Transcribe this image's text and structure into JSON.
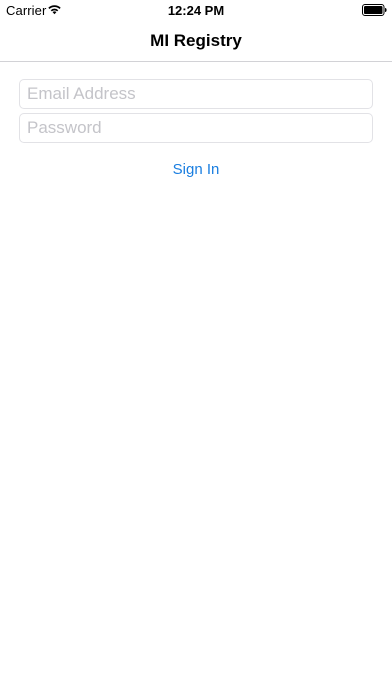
{
  "status_bar": {
    "carrier": "Carrier",
    "time": "12:24 PM",
    "icons": {
      "wifi": "wifi-icon",
      "battery": "battery-icon"
    }
  },
  "nav_bar": {
    "title": "MI Registry"
  },
  "login_form": {
    "email": {
      "value": "",
      "placeholder": "Email Address"
    },
    "password": {
      "value": "",
      "placeholder": "Password"
    },
    "sign_in_label": "Sign In"
  },
  "colors": {
    "accent": "#1a7ee0",
    "placeholder": "#c4c4c9",
    "field_border": "#e2e2e6",
    "separator": "#d2d2d6",
    "background": "#ffffff"
  }
}
